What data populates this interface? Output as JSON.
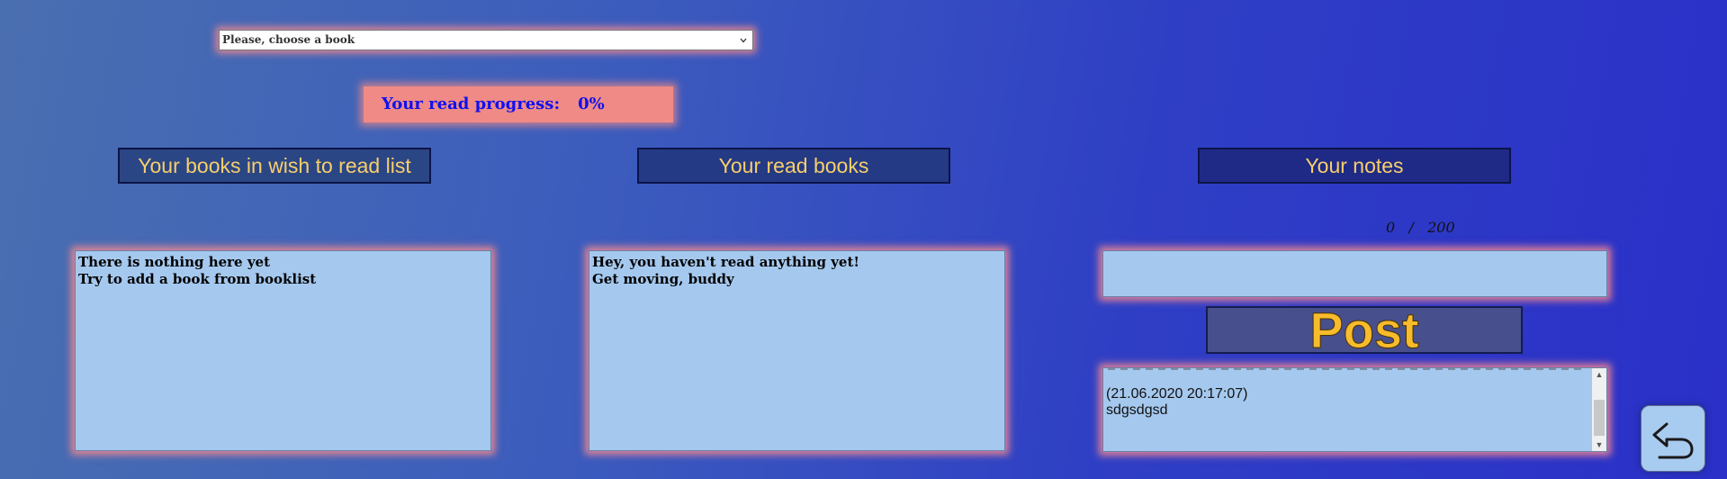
{
  "book_select": {
    "selected": "Please, choose a book",
    "icon": "chevron-down-icon"
  },
  "progress": {
    "label": "Your read progress:",
    "value": "0%",
    "fraction": 0
  },
  "sections": {
    "wish_title": "Your books in wish to read list",
    "read_title": "Your read books",
    "notes_title": "Your notes"
  },
  "wish_list": {
    "line1": "There is nothing here yet",
    "line2": "Try to add a book from booklist"
  },
  "read_list": {
    "line1": "Hey, you haven't read anything yet!",
    "line2": "Get moving, buddy"
  },
  "notes": {
    "char_count": "0",
    "separator": "/",
    "char_max": "200",
    "input_value": "",
    "post_label": "Post",
    "entries": [
      {
        "timestamp": "(21.06.2020 20:17:07)",
        "text": "sdgsdgsd"
      }
    ]
  },
  "back_button": {
    "icon": "undo-arrow-icon"
  },
  "colors": {
    "background_start": "#4a6fb0",
    "background_end": "#2a30c8",
    "panel": "#a5c8ee",
    "header_text": "#f7cf6a",
    "progress_text": "#1010f0",
    "progress_bg": "#ef8a86",
    "post_text": "#f7bb2c"
  }
}
